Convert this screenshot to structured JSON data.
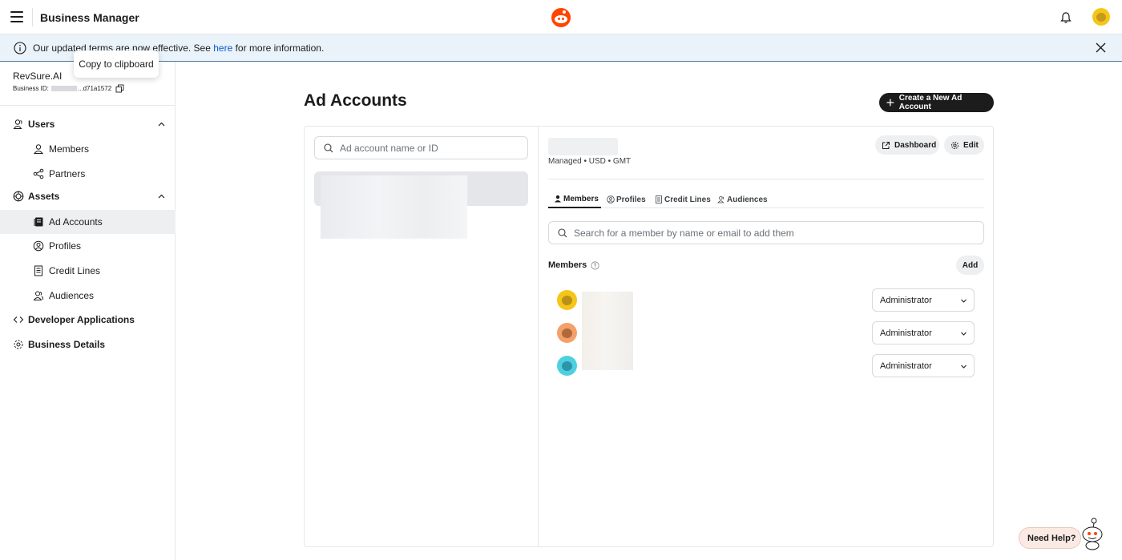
{
  "app": {
    "title": "Business Manager"
  },
  "colors": {
    "accent": "#ff4500",
    "link": "#0a58ca",
    "dark_button": "#1c1c1c"
  },
  "banner": {
    "text_before": "Our updated terms are now effective. See ",
    "link_text": "here",
    "text_after": " for more information."
  },
  "tooltip": {
    "text": "Copy to clipboard"
  },
  "business": {
    "name": "RevSure.AI",
    "id_label": "Business ID:",
    "id_suffix": "...d71a1572"
  },
  "sidebar": {
    "users": "Users",
    "members": "Members",
    "partners": "Partners",
    "assets": "Assets",
    "ad_accounts": "Ad Accounts",
    "profiles": "Profiles",
    "credit_lines": "Credit Lines",
    "audiences": "Audiences",
    "developer_applications": "Developer Applications",
    "business_details": "Business Details"
  },
  "main": {
    "title": "Ad Accounts",
    "create_button": "Create a New Ad Account",
    "account_search_placeholder": "Ad account name or ID"
  },
  "detail": {
    "meta": "Managed • USD • GMT",
    "dashboard_button": "Dashboard",
    "edit_button": "Edit",
    "tabs": {
      "members": "Members",
      "profiles": "Profiles",
      "credit_lines": "Credit Lines",
      "audiences": "Audiences"
    },
    "member_search_placeholder": "Search for a member by name or email to add them",
    "members_heading": "Members",
    "add_button": "Add",
    "member_roles": [
      "Administrator",
      "Administrator",
      "Administrator"
    ]
  },
  "help": {
    "label": "Need Help?"
  }
}
